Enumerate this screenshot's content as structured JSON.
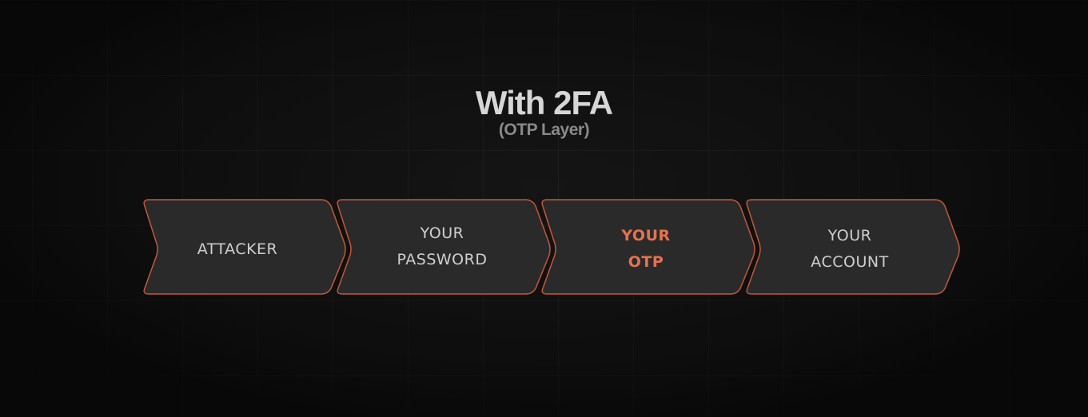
{
  "title": "With 2FA",
  "subtitle": "(OTP Layer)",
  "colors": {
    "background": "#121212",
    "box_fill": "#2a2a2a",
    "box_border": "#c4583a",
    "accent_text": "#e8714f",
    "text": "#cfcfcf"
  },
  "steps": [
    {
      "lines": [
        "ATTACKER"
      ],
      "highlight": false
    },
    {
      "lines": [
        "YOUR",
        "PASSWORD"
      ],
      "highlight": false
    },
    {
      "lines": [
        "YOUR",
        "OTP"
      ],
      "highlight": true
    },
    {
      "lines": [
        "YOUR",
        "ACCOUNT"
      ],
      "highlight": false
    }
  ]
}
